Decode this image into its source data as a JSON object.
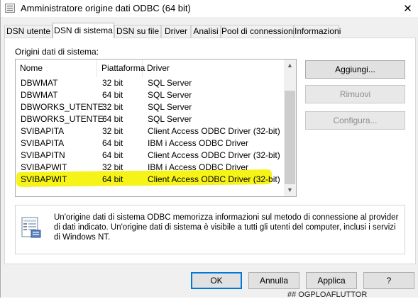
{
  "window": {
    "title": "Amministratore origine dati ODBC (64 bit)",
    "close_glyph": "✕"
  },
  "tabs": [
    {
      "label": "DSN utente",
      "active": false
    },
    {
      "label": "DSN di sistema",
      "active": true
    },
    {
      "label": "DSN su file",
      "active": false
    },
    {
      "label": "Driver",
      "active": false
    },
    {
      "label": "Analisi",
      "active": false
    },
    {
      "label": "Pool di connessioni",
      "active": false
    },
    {
      "label": "Informazioni",
      "active": false
    }
  ],
  "section_label": "Origini dati di sistema:",
  "list": {
    "columns": [
      "Nome",
      "Piattaforma",
      "Driver"
    ],
    "rows": [
      {
        "name": "DBWMAT",
        "platform": "32 bit",
        "driver": "SQL Server"
      },
      {
        "name": "DBWMAT",
        "platform": "64 bit",
        "driver": "SQL Server"
      },
      {
        "name": "DBWORKS_UTENTE",
        "platform": "32 bit",
        "driver": "SQL Server"
      },
      {
        "name": "DBWORKS_UTENTE",
        "platform": "64 bit",
        "driver": "SQL Server"
      },
      {
        "name": "SVIBAPITA",
        "platform": "32 bit",
        "driver": "Client Access ODBC Driver (32-bit)"
      },
      {
        "name": "SVIBAPITA",
        "platform": "64 bit",
        "driver": "IBM i Access ODBC Driver"
      },
      {
        "name": "SVIBAPITN",
        "platform": "64 bit",
        "driver": "Client Access ODBC Driver (32-bit)"
      },
      {
        "name": "SVIBAPWIT",
        "platform": "32 bit",
        "driver": "IBM i Access ODBC Driver"
      },
      {
        "name": "SVIBAPWIT",
        "platform": "64 bit",
        "driver": "Client Access ODBC Driver (32-bit)"
      }
    ],
    "highlight_color": "#f5f200"
  },
  "side_buttons": {
    "add": "Aggiungi...",
    "remove": "Rimuovi",
    "configure": "Configura..."
  },
  "info_text": "Un'origine dati di sistema ODBC memorizza informazioni sul metodo di connessione al provider di dati indicato. Un'origine dati di sistema è visibile a tutti gli utenti del computer, inclusi i servizi di Windows NT.",
  "bottom_buttons": {
    "ok": "OK",
    "cancel": "Annulla",
    "apply": "Applica",
    "help": "?"
  },
  "background_fragment": "## OGPLOAFLUTTOR",
  "colors": {
    "accent": "#0078d7"
  }
}
